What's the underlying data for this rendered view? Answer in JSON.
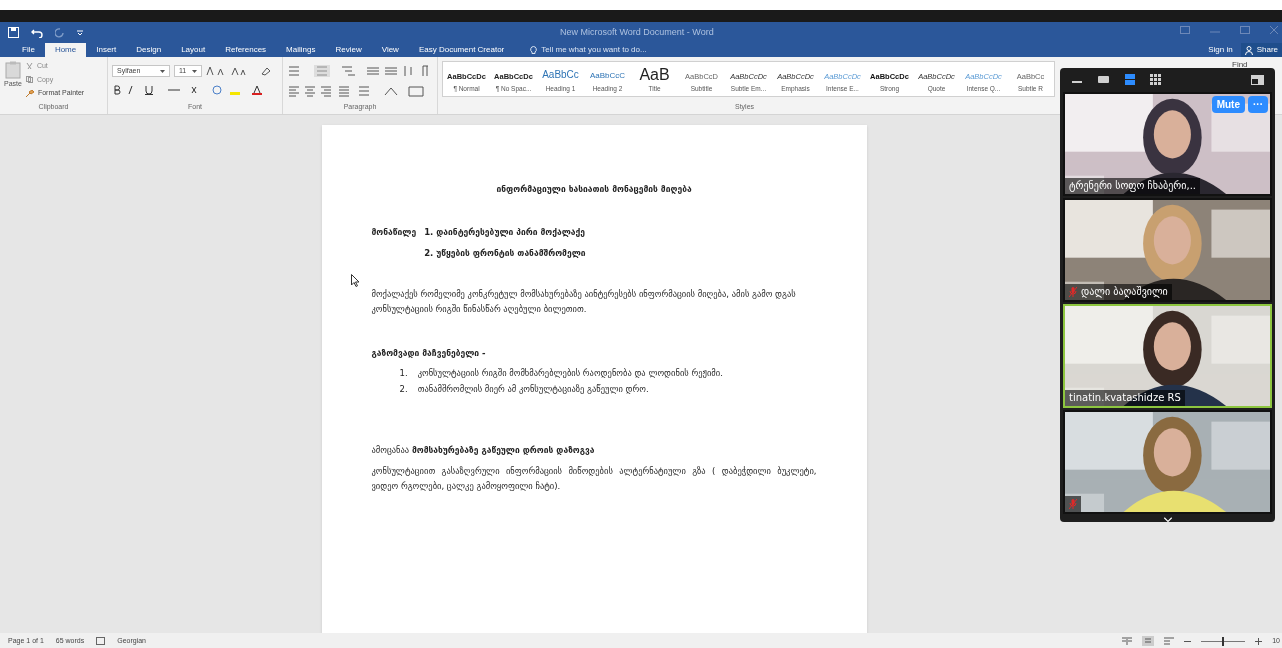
{
  "window": {
    "title": "New Microsoft Word Document - Word"
  },
  "tabs": [
    {
      "label": "File",
      "selected": false
    },
    {
      "label": "Home",
      "selected": true
    },
    {
      "label": "Insert",
      "selected": false
    },
    {
      "label": "Design",
      "selected": false
    },
    {
      "label": "Layout",
      "selected": false
    },
    {
      "label": "References",
      "selected": false
    },
    {
      "label": "Mailings",
      "selected": false
    },
    {
      "label": "Review",
      "selected": false
    },
    {
      "label": "View",
      "selected": false
    },
    {
      "label": "Easy Document Creator",
      "selected": false
    }
  ],
  "tell_me": "Tell me what you want to do...",
  "account": {
    "sign_in": "Sign in",
    "share": "Share"
  },
  "ribbon": {
    "clipboard": {
      "paste": "Paste",
      "cut": "Cut",
      "copy": "Copy",
      "format_painter": "Format Painter",
      "group": "Clipboard"
    },
    "font": {
      "name": "Sylfaen",
      "size": "11",
      "group": "Font"
    },
    "paragraph": {
      "group": "Paragraph"
    },
    "styles": {
      "group": "Styles",
      "items": [
        {
          "preview": "AaBbCcDc",
          "label": "¶ Normal",
          "kind": "normal"
        },
        {
          "preview": "AaBbCcDc",
          "label": "¶ No Spac...",
          "kind": "normal"
        },
        {
          "preview": "AaBbCc",
          "label": "Heading 1",
          "kind": "heading1"
        },
        {
          "preview": "AaBbCcC",
          "label": "Heading 2",
          "kind": "heading2"
        },
        {
          "preview": "AaB",
          "label": "Title",
          "kind": "title"
        },
        {
          "preview": "AaBbCcD",
          "label": "Subtitle",
          "kind": "subtitle"
        },
        {
          "preview": "AaBbCcDc",
          "label": "Subtle Em...",
          "kind": "italic"
        },
        {
          "preview": "AaBbCcDc",
          "label": "Emphasis",
          "kind": "italic"
        },
        {
          "preview": "AaBbCcDc",
          "label": "Intense E...",
          "kind": "intense"
        },
        {
          "preview": "AaBbCcDc",
          "label": "Strong",
          "kind": "strong"
        },
        {
          "preview": "AaBbCcDc",
          "label": "Quote",
          "kind": "italic"
        },
        {
          "preview": "AaBbCcDc",
          "label": "Intense Q...",
          "kind": "intense"
        },
        {
          "preview": "AaBbCc",
          "label": "Subtle R",
          "kind": "subtitle"
        }
      ]
    },
    "find": "Find"
  },
  "document": {
    "title": "ინფორმაციული ხასიათის მონაცემის მიღება",
    "participants_label": "მონაწილე",
    "participants": [
      "1. დაინტერესებული პირი მოქალაქე",
      "2. უწყების ფრონტის თანამშრომელი"
    ],
    "intro": "მოქალაქეს რომელიმე კონკრეტულ მომსახურებაზე აინტერესებს ინფორმაციის მიღება, ამის გამო დგას კონსულტაციის რიგში წინასწარ აღებული ბილეთით.",
    "metric_heading": "გაზომვადი მაჩვენებელი -",
    "metrics": [
      {
        "number": "1.",
        "text": "კონსულტაციის რიგში მომხმარებლების რაოდენობა და ლოდინის რეჟიმი."
      },
      {
        "number": "2.",
        "text": "თანამშრომლის მიერ ამ კონსულტაციაზე გაწეული დრო."
      }
    ],
    "task": "ამოცანაა  **მომსახურებაზე გაწეული დროის დაზოგვა**",
    "alternative": "კონსულტაციით გასაზღვრული ინფორმაციის მიწოდების ალტერნატიული გზა ( დაბეჭდილი ბუკლეტი, ვიდეო რგოლები, ცალკე გამოყოფილი ჩატი)."
  },
  "meeting": {
    "views": [
      {
        "kind": "minimize",
        "selected": false
      },
      {
        "kind": "speaker",
        "selected": false
      },
      {
        "kind": "strip",
        "selected": true
      },
      {
        "kind": "grid",
        "selected": false
      },
      {
        "kind": "popout",
        "selected": false
      }
    ],
    "mute": "Mute",
    "more": "···",
    "tiles": [
      {
        "name": "ტრენერი სოფო ჩხაბერი,..",
        "muted": false,
        "active": false
      },
      {
        "name": "დალი ბაღაშვილი",
        "muted": true,
        "active": false
      },
      {
        "name": "tinatin.kvatashidze RS",
        "muted": false,
        "active": true
      },
      {
        "muted": true,
        "active": false
      }
    ]
  },
  "status_bar": {
    "page": "Page 1 of 1",
    "words": "65 words",
    "language": "Georgian",
    "zoom": {
      "level": 0.5,
      "label": "10"
    }
  }
}
